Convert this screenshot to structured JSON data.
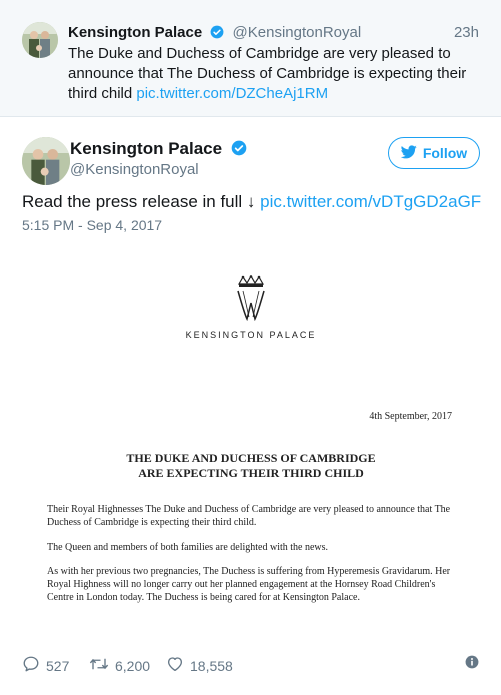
{
  "parent_tweet": {
    "name": "Kensington Palace",
    "handle": "@KensingtonRoyal",
    "time": "23h",
    "text": "The Duke and Duchess of Cambridge are very pleased to announce that The Duchess of Cambridge is expecting their third child",
    "link": "pic.twitter.com/DZCheAj1RM"
  },
  "main_tweet": {
    "name": "Kensington Palace",
    "handle": "@KensingtonRoyal",
    "follow_label": "Follow",
    "text": "Read the press release in full ↓",
    "link": "pic.twitter.com/vDTgGD2aGF",
    "timestamp": "5:15 PM - Sep 4, 2017"
  },
  "press_release": {
    "palace_label": "KENSINGTON PALACE",
    "date": "4th September, 2017",
    "title_line1": "THE DUKE AND DUCHESS OF CAMBRIDGE",
    "title_line2": "ARE EXPECTING THEIR THIRD CHILD",
    "paragraph1": "Their Royal Highnesses The Duke and Duchess of Cambridge are very pleased to announce that The Duchess of Cambridge is expecting their third child.",
    "paragraph2": "The Queen and members of both families are delighted with the news.",
    "paragraph3": "As with her previous two pregnancies, The Duchess is suffering from Hyperemesis Gravidarum.  Her Royal Highness will no longer carry out her planned engagement at the Hornsey Road Children's Centre in London today. The Duchess is being cared for at Kensington Palace."
  },
  "actions": {
    "replies": "527",
    "retweets": "6,200",
    "likes": "18,558"
  },
  "colors": {
    "accent": "#1da1f2",
    "muted": "#657786",
    "parent_bg": "#f5f8fa"
  }
}
